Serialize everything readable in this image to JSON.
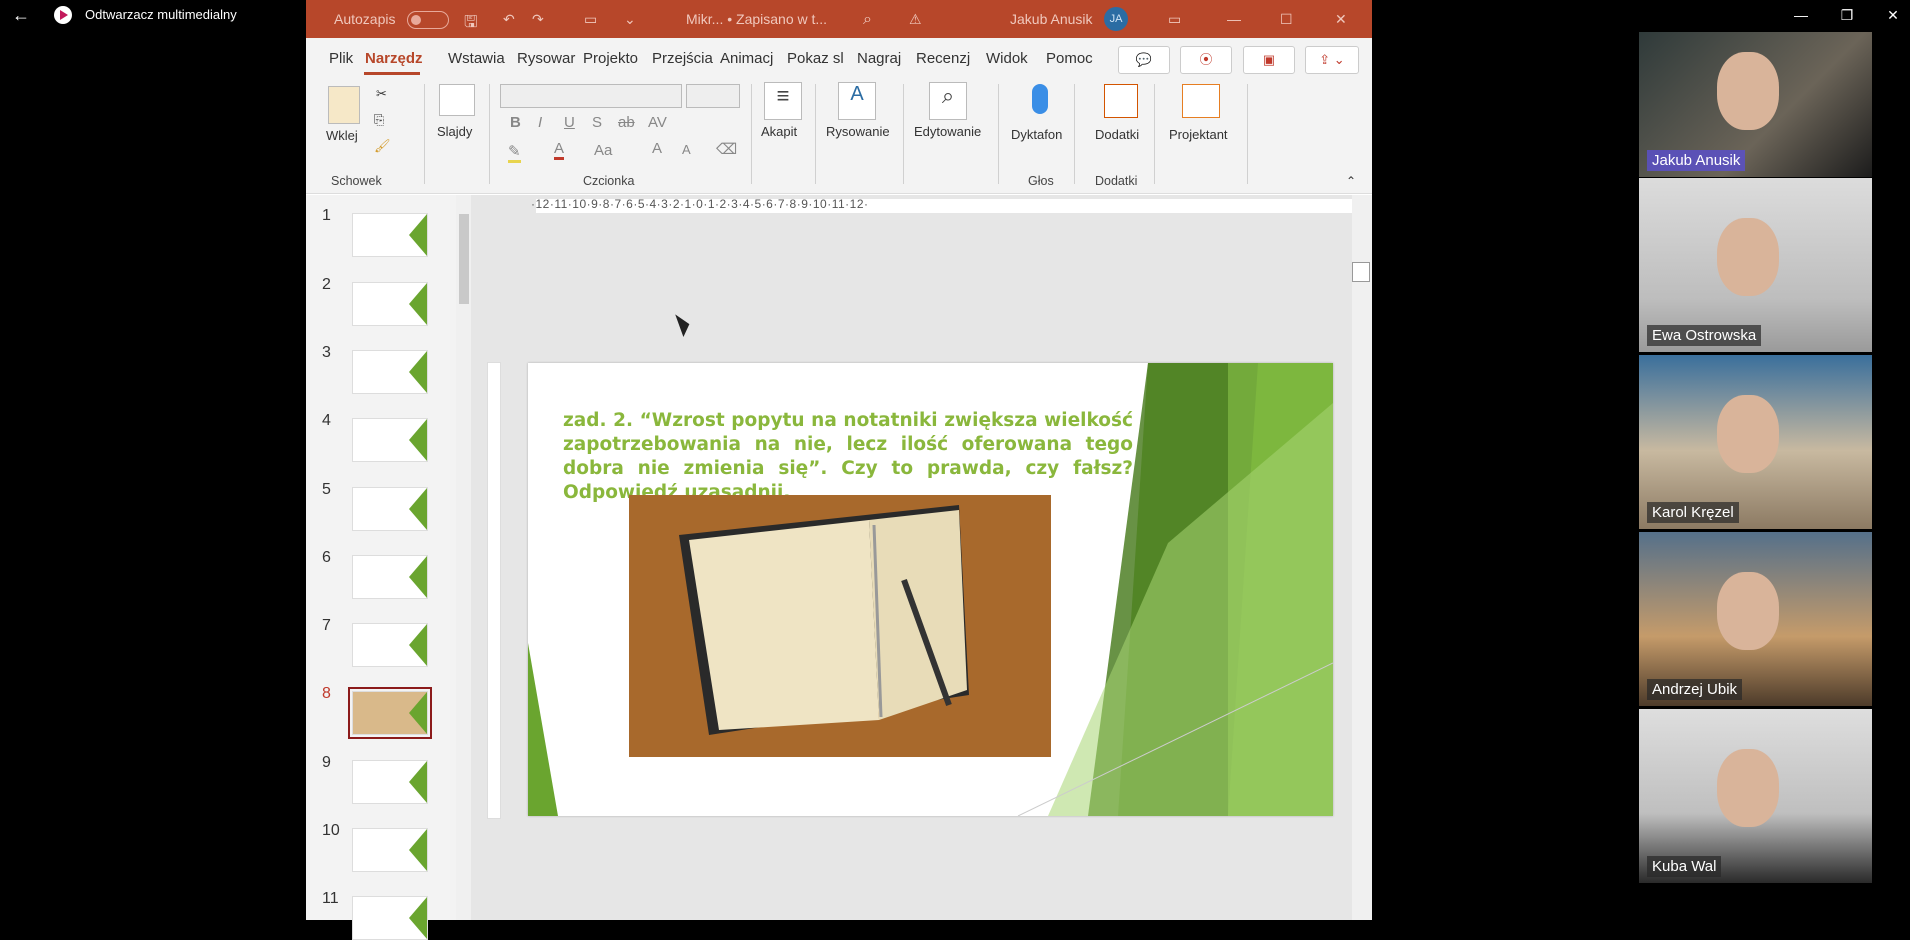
{
  "media_player": {
    "back_icon": "←",
    "app_title": "Odtwarzacz multimedialny",
    "window_controls": [
      "—",
      "❐",
      "✕"
    ]
  },
  "powerpoint": {
    "titlebar": {
      "autosave_label": "Autozapis",
      "doc_title": "Mikr... • Zapisano w t...",
      "user_name": "Jakub Anusik",
      "user_initials": "JA"
    },
    "tabs": [
      "Plik",
      "Narzędz",
      "Wstawia",
      "Rysowar",
      "Projekto",
      "Przejścia",
      "Animacj",
      "Pokaz sl",
      "Nagraj",
      "Recenzj",
      "Widok",
      "Pomoc"
    ],
    "active_tab": "Narzędz",
    "ribbon": {
      "paste_label": "Wklej",
      "slides_label": "Slajdy",
      "paragraph_label": "Akapit",
      "drawing_label": "Rysowanie",
      "editing_label": "Edytowanie",
      "dictate_label": "Dyktafon",
      "addins_label": "Dodatki",
      "designer_label": "Projektant",
      "group_clipboard": "Schowek",
      "group_font": "Czcionka",
      "group_voice": "Głos",
      "group_addins": "Dodatki",
      "format_buttons": [
        "B",
        "I",
        "U",
        "S",
        "ab",
        "AV"
      ],
      "font_size_buttons": [
        "Aa",
        "A",
        "A"
      ]
    },
    "ruler": "·12·11·10·9·8·7·6·5·4·3·2·1·0·1·2·3·4·5·6·7·8·9·10·11·12·",
    "slides": [
      {
        "number": "1"
      },
      {
        "number": "2"
      },
      {
        "number": "3"
      },
      {
        "number": "4"
      },
      {
        "number": "5"
      },
      {
        "number": "6"
      },
      {
        "number": "7"
      },
      {
        "number": "8"
      },
      {
        "number": "9"
      },
      {
        "number": "10"
      },
      {
        "number": "11"
      }
    ],
    "selected_slide": "8",
    "slide_text": "zad. 2. “Wzrost popytu na notatniki zwiększa wielkość zapotrzebowania na nie, lecz ilość oferowana tego dobra nie zmienia się”. Czy to prawda, czy fałsz? Odpowiedź uzasadnij."
  },
  "participants": [
    {
      "name": "Jakub Anusik"
    },
    {
      "name": "Ewa Ostrowska"
    },
    {
      "name": "Karol Kręzel"
    },
    {
      "name": "Andrzej Ubik"
    },
    {
      "name": "Kuba Wal"
    }
  ],
  "colors": {
    "ppt_accent": "#b7472a",
    "slide_text": "#8ab73c",
    "slide_green": "#6aa52f"
  }
}
